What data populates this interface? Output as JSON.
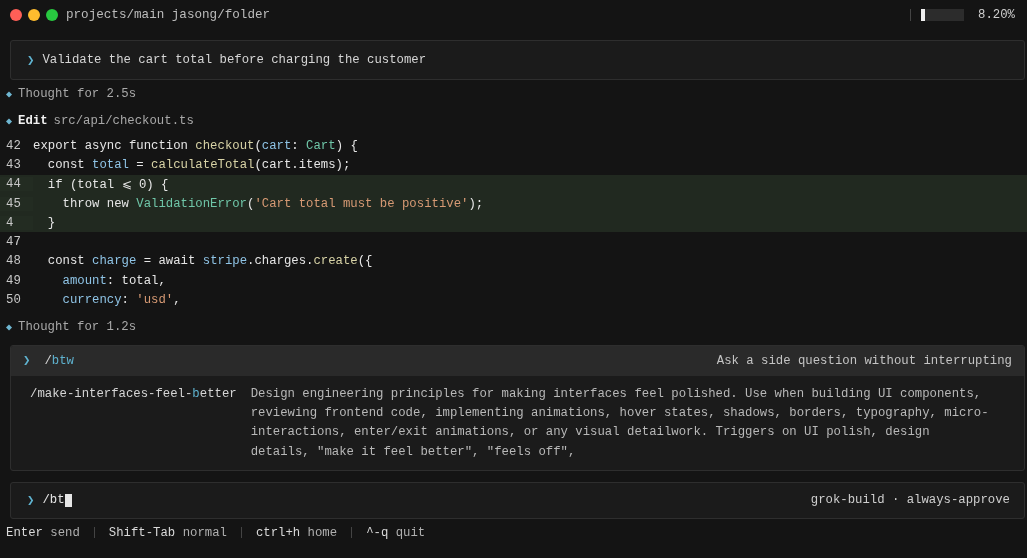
{
  "window": {
    "title": "projects/main jasong/folder"
  },
  "context_meter": {
    "level": 0.082,
    "reading": "8.20%"
  },
  "prompt": {
    "chevron": "❯",
    "text": "Validate the cart total before charging the customer"
  },
  "events": [
    {
      "kind": "thought",
      "marker": "◆",
      "label": "Thought for 2.5s"
    },
    {
      "kind": "edit",
      "marker": "◆",
      "action": "Edit",
      "path": "src/api/checkout.ts"
    }
  ],
  "code": [
    {
      "number": "42",
      "added": false,
      "tokens": [
        {
          "kind": "plain",
          "text": "export async function "
        },
        {
          "kind": "fn",
          "text": "checkout"
        },
        {
          "kind": "plain",
          "text": "("
        },
        {
          "kind": "var",
          "text": "cart"
        },
        {
          "kind": "plain",
          "text": ": "
        },
        {
          "kind": "type",
          "text": "Cart"
        },
        {
          "kind": "plain",
          "text": ") {"
        }
      ]
    },
    {
      "number": "43",
      "added": false,
      "tokens": [
        {
          "kind": "plain",
          "text": "  const "
        },
        {
          "kind": "var",
          "text": "total"
        },
        {
          "kind": "plain",
          "text": " = "
        },
        {
          "kind": "fn",
          "text": "calculateTotal"
        },
        {
          "kind": "plain",
          "text": "(cart.items);"
        }
      ]
    },
    {
      "number": "44",
      "added": true,
      "tokens": [
        {
          "kind": "plain",
          "text": "  if (total ⩽ 0) {"
        }
      ]
    },
    {
      "number": "45",
      "added": true,
      "tokens": [
        {
          "kind": "plain",
          "text": "    throw new "
        },
        {
          "kind": "type",
          "text": "ValidationError"
        },
        {
          "kind": "plain",
          "text": "("
        },
        {
          "kind": "str",
          "text": "'Cart total must be positive'"
        },
        {
          "kind": "plain",
          "text": ");"
        }
      ]
    },
    {
      "number": "4",
      "added": true,
      "tokens": [
        {
          "kind": "plain",
          "text": "  }"
        }
      ]
    },
    {
      "number": "47",
      "added": false
    },
    {
      "number": "48",
      "added": false,
      "tokens": [
        {
          "kind": "plain",
          "text": "  const "
        },
        {
          "kind": "var",
          "text": "charge"
        },
        {
          "kind": "plain",
          "text": " = await "
        },
        {
          "kind": "var",
          "text": "stripe"
        },
        {
          "kind": "plain",
          "text": ".charges."
        },
        {
          "kind": "fn",
          "text": "create"
        },
        {
          "kind": "plain",
          "text": "({"
        }
      ]
    },
    {
      "number": "49",
      "added": false,
      "tokens": [
        {
          "kind": "var",
          "text": "    amount"
        },
        {
          "kind": "plain",
          "text": ": total,"
        }
      ]
    },
    {
      "number": "50",
      "added": false,
      "tokens": [
        {
          "kind": "var",
          "text": "    currency"
        },
        {
          "kind": "plain",
          "text": ": "
        },
        {
          "kind": "str",
          "text": "'usd'"
        },
        {
          "kind": "plain",
          "text": ","
        }
      ]
    }
  ],
  "thought_after": {
    "marker": "◆",
    "label": "Thought for 1.2s"
  },
  "command_menu": {
    "chevron": "❯",
    "query": [
      {
        "text": "/",
        "match": false
      },
      {
        "text": "btw",
        "match": true
      }
    ],
    "hint": "Ask a side question without interrupting",
    "suggestions": [
      {
        "selected": false,
        "name": [
          {
            "text": "/make-interfaces-feel-",
            "match": false
          },
          {
            "text": "b",
            "match": true
          },
          {
            "text": "etter",
            "match": false
          }
        ],
        "description": "Design engineering principles for making interfaces feel polished. Use when building UI components, reviewing frontend code, implementing animations, hover states, shadows, borders, typography, micro-interactions, enter/exit animations, or any visual detailwork. Triggers on UI polish, design details, \"make it feel better\", \"feels off\","
      }
    ]
  },
  "input": {
    "chevron": "❯",
    "value": "/bt",
    "mode": "grok-build · always-approve"
  },
  "status_bar": [
    {
      "key": "Enter",
      "action": "send"
    },
    {
      "key": "Shift-Tab",
      "action": "normal"
    },
    {
      "key": "ctrl+h",
      "action": "home"
    },
    {
      "key": "^-q",
      "action": "quit"
    }
  ]
}
